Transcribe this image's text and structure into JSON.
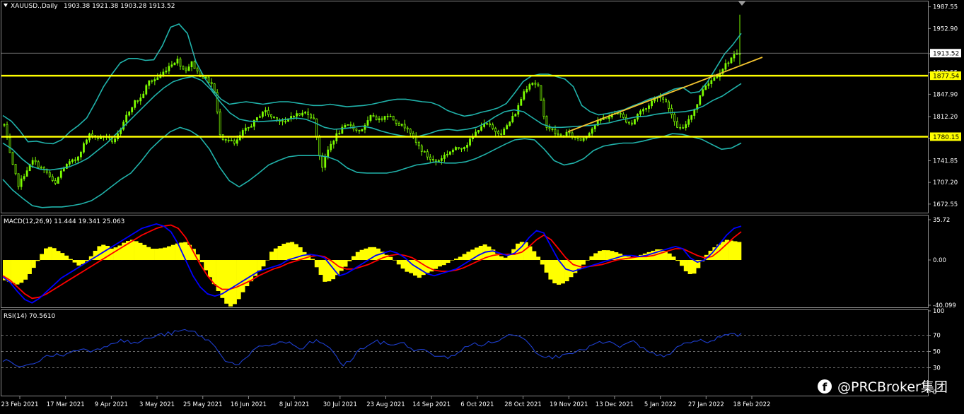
{
  "colors": {
    "background": "#000000",
    "candle": "#7CFC00",
    "bollinger": "#20B2AA",
    "level_line": "#FFFF00",
    "trendline": "#F4C430",
    "macd_hist": "#FFFF00",
    "macd_main": "#0000FF",
    "macd_signal": "#FF0000",
    "rsi": "#1E3FD0",
    "frame": "#8c8c8c"
  },
  "watermark": {
    "icon": "facebook-icon",
    "text": "@PRCBroker集团"
  },
  "chart_data": [
    {
      "type": "candlestick",
      "title": "XAUUSD.,Daily",
      "ohlc_text": "1903.38 1921.38 1903.28 1913.52",
      "y_ticks": [
        "1987.55",
        "1952.90",
        "1912.70",
        "1882.55",
        "1847.90",
        "1812.20",
        "1777.55",
        "1741.85",
        "1707.20",
        "1672.55"
      ],
      "ylim": [
        1660,
        1995
      ],
      "x_tick_labels": [
        "23 Feb 2021",
        "17 Mar 2021",
        "9 Apr 2021",
        "3 May 2021",
        "25 May 2021",
        "16 Jun 2021",
        "8 Jul 2021",
        "30 Jul 2021",
        "23 Aug 2021",
        "14 Sep 2021",
        "6 Oct 2021",
        "28 Oct 2021",
        "19 Nov 2021",
        "13 Dec 2021",
        "5 Jan 2022",
        "27 Jan 2022",
        "18 Feb 2022"
      ],
      "horizontal_levels": [
        {
          "value": 1877.54,
          "label": "1877.54"
        },
        {
          "value": 1780.15,
          "label": "1780.15"
        }
      ],
      "current_price": {
        "value": 1913.52,
        "label": "1913.52"
      },
      "trendline": {
        "from": {
          "x": "22 Nov 2021",
          "y": 1788
        },
        "to": {
          "x": "24 Feb 2022",
          "y": 1907
        }
      },
      "close_path": [
        1799,
        1740,
        1702,
        1725,
        1742,
        1731,
        1722,
        1702,
        1728,
        1738,
        1744,
        1767,
        1786,
        1778,
        1782,
        1773,
        1785,
        1815,
        1835,
        1842,
        1868,
        1872,
        1882,
        1895,
        1903,
        1885,
        1898,
        1880,
        1872,
        1862,
        1780,
        1775,
        1768,
        1787,
        1796,
        1808,
        1823,
        1812,
        1808,
        1802,
        1816,
        1815,
        1820,
        1806,
        1729,
        1762,
        1782,
        1794,
        1800,
        1788,
        1796,
        1815,
        1806,
        1817,
        1808,
        1798,
        1795,
        1772,
        1757,
        1745,
        1740,
        1750,
        1758,
        1762,
        1766,
        1780,
        1797,
        1800,
        1790,
        1786,
        1802,
        1820,
        1851,
        1868,
        1863,
        1800,
        1790,
        1780,
        1786,
        1780,
        1775,
        1786,
        1800,
        1810,
        1812,
        1820,
        1808,
        1800,
        1820,
        1825,
        1840,
        1845,
        1833,
        1800,
        1790,
        1810,
        1830,
        1860,
        1870,
        1880,
        1895,
        1908,
        1913
      ],
      "bollinger_upper": [
        1814,
        1805,
        1790,
        1772,
        1773,
        1770,
        1769,
        1775,
        1788,
        1798,
        1810,
        1834,
        1860,
        1880,
        1898,
        1905,
        1905,
        1902,
        1903,
        1925,
        1955,
        1960,
        1945,
        1900,
        1875,
        1855,
        1840,
        1832,
        1834,
        1836,
        1834,
        1832,
        1834,
        1836,
        1836,
        1834,
        1832,
        1830,
        1830,
        1832,
        1830,
        1828,
        1829,
        1830,
        1832,
        1835,
        1838,
        1840,
        1840,
        1838,
        1836,
        1835,
        1830,
        1822,
        1817,
        1813,
        1815,
        1819,
        1822,
        1826,
        1833,
        1850,
        1868,
        1877,
        1880,
        1880,
        1876,
        1872,
        1860,
        1830,
        1820,
        1815,
        1817,
        1820,
        1823,
        1829,
        1834,
        1840,
        1844,
        1850,
        1856,
        1859,
        1850,
        1852,
        1868,
        1890,
        1912,
        1927,
        1945
      ],
      "bollinger_middle": [
        1770,
        1760,
        1745,
        1733,
        1728,
        1727,
        1729,
        1732,
        1738,
        1746,
        1758,
        1770,
        1785,
        1800,
        1815,
        1830,
        1845,
        1858,
        1868,
        1873,
        1876,
        1870,
        1855,
        1835,
        1818,
        1808,
        1805,
        1804,
        1805,
        1806,
        1808,
        1810,
        1808,
        1802,
        1795,
        1792,
        1793,
        1795,
        1797,
        1794,
        1789,
        1785,
        1782,
        1780,
        1781,
        1785,
        1790,
        1792,
        1790,
        1792,
        1795,
        1802,
        1812,
        1820,
        1823,
        1820,
        1810,
        1800,
        1795,
        1795,
        1796,
        1797,
        1798,
        1800,
        1802,
        1806,
        1809,
        1812,
        1813,
        1816,
        1818,
        1819,
        1820,
        1823,
        1829,
        1838,
        1845,
        1855,
        1865
      ],
      "bollinger_lower": [
        1712,
        1695,
        1682,
        1670,
        1667,
        1668,
        1668,
        1670,
        1673,
        1678,
        1688,
        1700,
        1712,
        1722,
        1740,
        1760,
        1775,
        1788,
        1795,
        1790,
        1780,
        1760,
        1732,
        1710,
        1700,
        1710,
        1722,
        1735,
        1742,
        1748,
        1750,
        1750,
        1750,
        1748,
        1742,
        1730,
        1723,
        1722,
        1722,
        1722,
        1725,
        1730,
        1735,
        1737,
        1740,
        1738,
        1738,
        1740,
        1745,
        1752,
        1760,
        1768,
        1775,
        1777,
        1775,
        1760,
        1742,
        1735,
        1738,
        1745,
        1758,
        1765,
        1768,
        1770,
        1770,
        1773,
        1777,
        1780,
        1785,
        1784,
        1780,
        1776,
        1768,
        1760,
        1762,
        1770
      ]
    },
    {
      "type": "macd",
      "title": "MACD(12,26,9) 11.444 19.341 25.063",
      "y_ticks": [
        "35.72",
        "0.00",
        "-40.099"
      ],
      "ylim": [
        -40.099,
        35.72
      ],
      "histogram": [
        -18,
        -20,
        -22,
        -18,
        -10,
        0,
        10,
        12,
        8,
        5,
        0,
        -5,
        -3,
        4,
        12,
        14,
        10,
        12,
        16,
        18,
        16,
        13,
        10,
        10,
        11,
        13,
        15,
        16,
        12,
        4,
        -8,
        -18,
        -28,
        -38,
        -42,
        -35,
        -25,
        -18,
        -10,
        -4,
        8,
        12,
        15,
        16,
        13,
        6,
        2,
        -10,
        -20,
        -18,
        -12,
        -6,
        2,
        8,
        10,
        12,
        10,
        5,
        2,
        -4,
        -10,
        -12,
        -16,
        -12,
        -10,
        -6,
        -4,
        0,
        2,
        6,
        9,
        12,
        14,
        10,
        4,
        2,
        8,
        16,
        16,
        10,
        2,
        -10,
        -20,
        -22,
        -20,
        -14,
        -8,
        -2,
        4,
        8,
        9,
        8,
        6,
        4,
        2,
        4,
        6,
        8,
        10,
        8,
        4,
        -2,
        -10,
        -14,
        -6,
        4,
        10,
        14,
        18,
        17,
        16
      ],
      "macd_line": [
        -15,
        -20,
        -28,
        -35,
        -38,
        -34,
        -28,
        -22,
        -16,
        -12,
        -8,
        -4,
        0,
        4,
        8,
        12,
        16,
        20,
        24,
        28,
        30,
        32,
        30,
        25,
        14,
        0,
        -14,
        -24,
        -30,
        -32,
        -30,
        -26,
        -22,
        -18,
        -14,
        -10,
        -8,
        -6,
        -4,
        0,
        2,
        4,
        5,
        4,
        2,
        -6,
        -14,
        -12,
        -8,
        -4,
        0,
        4,
        6,
        8,
        6,
        2,
        -4,
        -8,
        -12,
        -14,
        -12,
        -10,
        -8,
        -4,
        0,
        4,
        7,
        8,
        6,
        4,
        6,
        12,
        20,
        26,
        24,
        12,
        0,
        -8,
        -10,
        -8,
        -6,
        -4,
        -2,
        0,
        2,
        4,
        4,
        3,
        4,
        6,
        8,
        10,
        12,
        10,
        2,
        -2,
        0,
        6,
        14,
        22,
        28,
        30
      ],
      "signal_line": [
        -14,
        -18,
        -24,
        -30,
        -34,
        -33,
        -30,
        -26,
        -22,
        -18,
        -14,
        -10,
        -6,
        -2,
        2,
        6,
        10,
        14,
        18,
        22,
        25,
        28,
        30,
        31,
        28,
        20,
        8,
        -4,
        -14,
        -22,
        -26,
        -26,
        -24,
        -21,
        -18,
        -14,
        -11,
        -8,
        -6,
        -3,
        -1,
        1,
        3,
        4,
        3,
        -1,
        -6,
        -8,
        -8,
        -6,
        -4,
        -1,
        2,
        4,
        5,
        4,
        2,
        -2,
        -6,
        -9,
        -10,
        -10,
        -9,
        -7,
        -4,
        -1,
        2,
        4,
        5,
        5,
        5,
        7,
        12,
        18,
        22,
        18,
        10,
        2,
        -4,
        -6,
        -6,
        -5,
        -4,
        -2,
        0,
        1,
        2,
        3,
        3,
        4,
        6,
        8,
        10,
        10,
        7,
        4,
        2,
        3,
        8,
        14,
        20,
        25
      ]
    },
    {
      "type": "line",
      "title": "RSI(14) 70.5610",
      "y_ticks": [
        "100",
        "70",
        "50",
        "30",
        "0"
      ],
      "ylim": [
        0,
        100
      ],
      "levels": [
        70,
        50,
        30
      ],
      "values": [
        40,
        36,
        30,
        32,
        38,
        42,
        46,
        45,
        48,
        52,
        54,
        50,
        56,
        60,
        64,
        62,
        60,
        64,
        68,
        70,
        72,
        74,
        76,
        74,
        68,
        62,
        50,
        38,
        34,
        38,
        48,
        56,
        58,
        60,
        62,
        58,
        52,
        60,
        64,
        56,
        48,
        32,
        40,
        52,
        58,
        62,
        60,
        58,
        62,
        54,
        52,
        50,
        46,
        42,
        44,
        50,
        56,
        60,
        58,
        62,
        64,
        70,
        72,
        66,
        52,
        46,
        42,
        44,
        50,
        48,
        52,
        58,
        60,
        62,
        56,
        58,
        62,
        54,
        48,
        44,
        46,
        52,
        58,
        62,
        64,
        60,
        66,
        70,
        72,
        70
      ]
    }
  ]
}
